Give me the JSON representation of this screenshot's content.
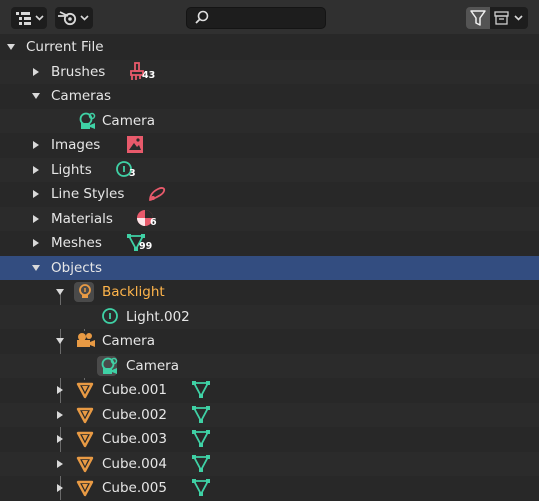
{
  "header": {
    "search_value": "",
    "display_mode_icon": "outliner-display-icon",
    "blend_icon": "blender-logo-icon",
    "filter_icon": "funnel-icon",
    "new_collection_icon": "new-collection-icon"
  },
  "tree": {
    "root": {
      "label": "Current File"
    },
    "brushes": {
      "label": "Brushes",
      "count": "43"
    },
    "cameras": {
      "label": "Cameras"
    },
    "camera_data": {
      "label": "Camera"
    },
    "images": {
      "label": "Images"
    },
    "lights": {
      "label": "Lights",
      "count": "3"
    },
    "line_styles": {
      "label": "Line Styles"
    },
    "materials": {
      "label": "Materials",
      "count": "6"
    },
    "meshes": {
      "label": "Meshes",
      "count": "99"
    },
    "objects": {
      "label": "Objects"
    },
    "backlight": {
      "label": "Backlight"
    },
    "light002": {
      "label": "Light.002"
    },
    "camera_obj": {
      "label": "Camera"
    },
    "camera_obj_data": {
      "label": "Camera"
    },
    "cube001": {
      "label": "Cube.001"
    },
    "cube002": {
      "label": "Cube.002"
    },
    "cube003": {
      "label": "Cube.003"
    },
    "cube004": {
      "label": "Cube.004"
    },
    "cube005": {
      "label": "Cube.005"
    }
  },
  "colors": {
    "brush": "#e85a6b",
    "data_green": "#3fd1a5",
    "object_orange": "#e89a44",
    "active_name": "#ffb54b",
    "selected_row": "#334d80"
  }
}
